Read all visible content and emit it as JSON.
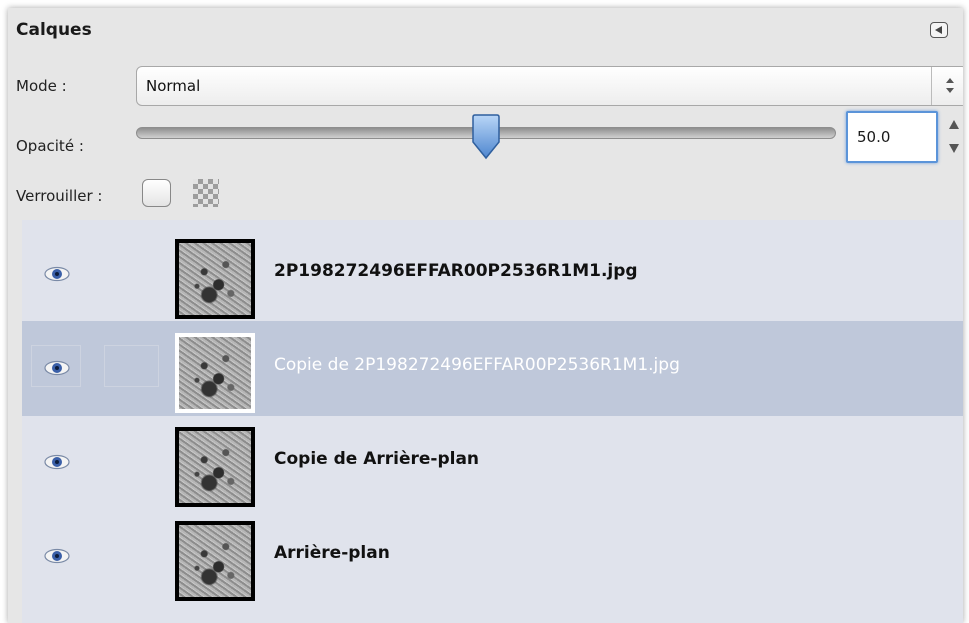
{
  "panel": {
    "title": "Calques"
  },
  "mode": {
    "label": "Mode :",
    "value": "Normal"
  },
  "opacity": {
    "label": "Opacité :",
    "value": "50.0",
    "level_percent": 50
  },
  "lock": {
    "label": "Verrouiller :"
  },
  "layers": [
    {
      "name": "2P198272496EFFAR00P2536R1M1.jpg",
      "visible": true,
      "selected": false
    },
    {
      "name": "Copie de 2P198272496EFFAR00P2536R1M1.jpg",
      "visible": true,
      "selected": true
    },
    {
      "name": "Copie de Arrière-plan",
      "visible": true,
      "selected": false
    },
    {
      "name": "Arrière-plan",
      "visible": true,
      "selected": false
    }
  ],
  "colors": {
    "selected_row": "#bfc8da",
    "list_background": "#e0e3ec",
    "panel_background": "#e6e6e6",
    "focus_ring": "#5b94d9"
  },
  "icons": {
    "collapse": "collapse-left-icon",
    "visibility": "eye-icon",
    "mode_arrows": "updown-arrows-icon",
    "lock_alpha": "checkerboard-icon"
  }
}
